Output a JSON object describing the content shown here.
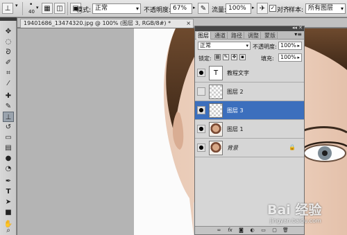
{
  "options_bar": {
    "brush_size": "40",
    "mode_label": "模式:",
    "mode_value": "正常",
    "opacity_label": "不透明度:",
    "opacity_value": "67%",
    "flow_label": "流量:",
    "flow_value": "100%",
    "align_label": "对齐",
    "sample_label": "样本:",
    "sample_value": "所有图层"
  },
  "document": {
    "tab_title": "19401686_13474320.jpg @ 100% (图层 3, RGB/8#) *",
    "close_glyph": "×"
  },
  "layers_panel": {
    "tabs": [
      "图层",
      "通道",
      "路径",
      "调整",
      "蒙版"
    ],
    "active_tab": "图层",
    "blend_mode": "正常",
    "opacity_label": "不透明度:",
    "opacity_value": "100%",
    "lock_label": "锁定:",
    "fill_label": "填充:",
    "fill_value": "100%",
    "layers": [
      {
        "name": "教程文字",
        "thumb": "T",
        "visible": true,
        "selected": false
      },
      {
        "name": "图层 2",
        "thumb": "",
        "visible": false,
        "selected": false
      },
      {
        "name": "图层 3",
        "thumb": "",
        "visible": true,
        "selected": true
      },
      {
        "name": "图层 1",
        "thumb": "",
        "visible": true,
        "selected": false
      },
      {
        "name": "背景",
        "thumb": "",
        "visible": true,
        "selected": false,
        "locked": true
      }
    ]
  },
  "watermark": {
    "text": "Bai 经验",
    "sub": "jingyan.baidu.com"
  },
  "colors": {
    "selection": "#3c6fbd",
    "panel": "#d6d6d6",
    "workspace": "#b4b4b4"
  },
  "icons": {
    "tools": [
      "move-icon",
      "marquee-icon",
      "lasso-icon",
      "quick-select-icon",
      "crop-icon",
      "eyedropper-icon",
      "healing-icon",
      "brush-icon",
      "clone-stamp-icon",
      "history-brush-icon",
      "eraser-icon",
      "gradient-icon",
      "blur-icon",
      "dodge-icon",
      "pen-icon",
      "type-icon",
      "path-select-icon",
      "shape-icon",
      "hand-icon",
      "zoom-icon"
    ]
  }
}
